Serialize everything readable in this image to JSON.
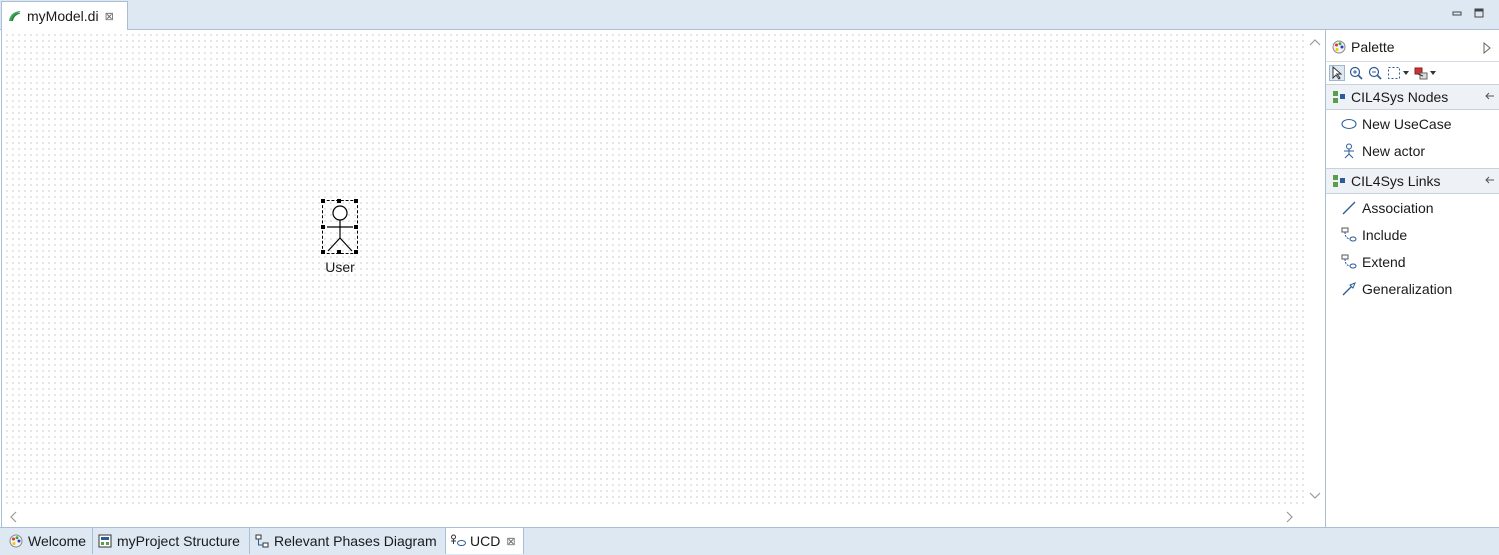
{
  "editor_tab": {
    "title": "myModel.di",
    "close": "⊠"
  },
  "diagram": {
    "actor": {
      "name": "User"
    }
  },
  "palette": {
    "title": "Palette",
    "drawers": [
      {
        "title": "CIL4Sys Nodes",
        "items": [
          "New UseCase",
          "New actor"
        ]
      },
      {
        "title": "CIL4Sys Links",
        "items": [
          "Association",
          "Include",
          "Extend",
          "Generalization"
        ]
      }
    ]
  },
  "bottom_tabs": [
    {
      "label": "Welcome"
    },
    {
      "label": "myProject Structure"
    },
    {
      "label": "Relevant Phases Diagram"
    },
    {
      "label": "UCD",
      "close": "⊠"
    }
  ],
  "colors": {
    "chrome": "#dde8f3",
    "border": "#a9bfd6",
    "icon_blue": "#2c5b9a"
  }
}
